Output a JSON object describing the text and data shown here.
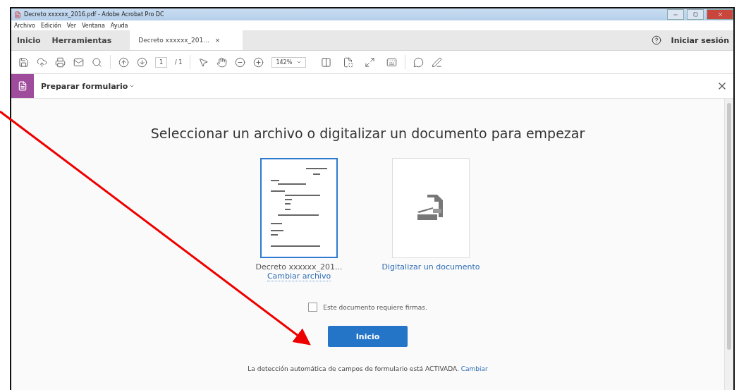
{
  "window": {
    "title": "Decreto xxxxxx_2016.pdf - Adobe Acrobat Pro DC"
  },
  "menu": [
    "Archivo",
    "Edición",
    "Ver",
    "Ventana",
    "Ayuda"
  ],
  "tabs": [
    {
      "label": "Inicio",
      "kind": "nav",
      "selected": false
    },
    {
      "label": "Herramientas",
      "kind": "nav",
      "selected": false
    },
    {
      "label": "Decreto xxxxxx_201...",
      "kind": "document",
      "selected": true,
      "close": "×"
    }
  ],
  "sign_in": "Iniciar sesión",
  "toolbar": {
    "page": "1",
    "page_total": "/ 1",
    "zoom": "142%"
  },
  "tool_panel": {
    "title": "Preparar formulario"
  },
  "content": {
    "heading": "Seleccionar un archivo o digitalizar un documento para empezar",
    "options": [
      {
        "kind": "file",
        "label": "Decreto xxxxxx_201...",
        "link": "Cambiar archivo",
        "selected": true
      },
      {
        "kind": "scan",
        "link": "Digitalizar un documento",
        "selected": false
      }
    ],
    "signature_checkbox": {
      "label": "Este documento requiere firmas.",
      "checked": false
    },
    "start_button": "Inicio",
    "footer": {
      "text": "La detección automática de campos de formulario está ACTIVADA.",
      "link": "Cambiar"
    }
  }
}
